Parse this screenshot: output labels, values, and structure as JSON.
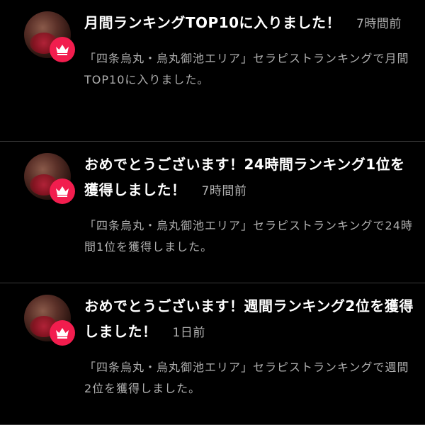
{
  "notifications": [
    {
      "title": "月間ランキングTOP10に入りました！",
      "time": "7時間前",
      "body": "「四条烏丸・烏丸御池エリア」セラピストランキングで月間TOP10に入りました。"
    },
    {
      "title": "おめでとうございます！24時間ランキング1位を獲得しました！",
      "time": "7時間前",
      "body": "「四条烏丸・烏丸御池エリア」セラピストランキングで24時間1位を獲得しました。"
    },
    {
      "title": "おめでとうございます！週間ランキング2位を獲得しました！",
      "time": "1日前",
      "body": "「四条烏丸・烏丸御池エリア」セラピストランキングで週間2位を獲得しました。"
    }
  ],
  "colors": {
    "background": "#000000",
    "badge": "#f21d4e",
    "title": "#ffffff",
    "secondary_text": "#b0b0b0",
    "divider": "#3a3a3a"
  },
  "icons": {
    "avatar": "avatar",
    "badge": "crown-icon"
  }
}
